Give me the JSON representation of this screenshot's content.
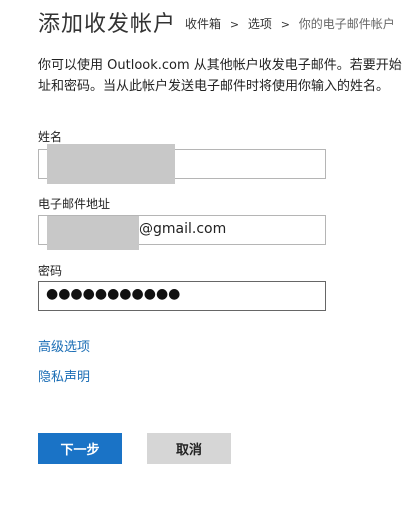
{
  "header": {
    "title": "添加收发帐户",
    "breadcrumb": {
      "items": [
        "收件箱",
        "选项"
      ],
      "separator": ">",
      "current": "你的电子邮件帐户"
    }
  },
  "description": {
    "line1": "你可以使用 Outlook.com 从其他帐户收发电子邮件。若要开始",
    "line2": "址和密码。当从此帐户发送电子邮件时将使用你输入的姓名。"
  },
  "form": {
    "name": {
      "label": "姓名",
      "value": ""
    },
    "email": {
      "label": "电子邮件地址",
      "visible_suffix": "@gmail.com"
    },
    "password": {
      "label": "密码",
      "masked_value": "●●●●●●●●●●●"
    }
  },
  "links": {
    "advanced": "高级选项",
    "privacy": "隐私声明"
  },
  "buttons": {
    "next": "下一步",
    "cancel": "取消"
  },
  "colors": {
    "primary_button": "#1a73c6",
    "secondary_button": "#d6d6d6",
    "link": "#1a6db5",
    "redaction": "#c8c8c8"
  }
}
